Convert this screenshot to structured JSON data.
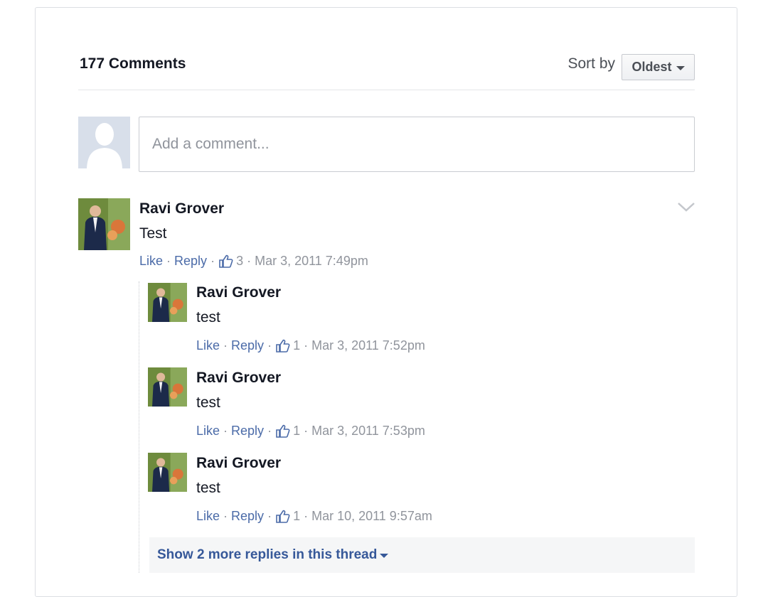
{
  "header": {
    "comment_count": "177 Comments",
    "sort_label": "Sort by",
    "sort_value": "Oldest"
  },
  "composer": {
    "placeholder": "Add a comment..."
  },
  "comments": [
    {
      "author": "Ravi Grover",
      "text": "Test",
      "like": "Like",
      "reply": "Reply",
      "likes": "3",
      "time": "Mar 3, 2011 7:49pm"
    }
  ],
  "replies": [
    {
      "author": "Ravi Grover",
      "text": "test",
      "like": "Like",
      "reply": "Reply",
      "likes": "1",
      "time": "Mar 3, 2011 7:52pm"
    },
    {
      "author": "Ravi Grover",
      "text": "test",
      "like": "Like",
      "reply": "Reply",
      "likes": "1",
      "time": "Mar 3, 2011 7:53pm"
    },
    {
      "author": "Ravi Grover",
      "text": "test",
      "like": "Like",
      "reply": "Reply",
      "likes": "1",
      "time": "Mar 10, 2011 9:57am"
    }
  ],
  "more_replies": "Show 2 more replies in this thread",
  "icons": {
    "default_avatar": "person-silhouette-icon",
    "thumb": "thumbs-up-icon",
    "options": "chevron-down-icon",
    "sort_caret": "caret-down-icon"
  },
  "colors": {
    "link": "#4b6ba8",
    "more_link": "#365899",
    "muted": "#90949c",
    "avatar_placeholder": "#d8dfea"
  }
}
